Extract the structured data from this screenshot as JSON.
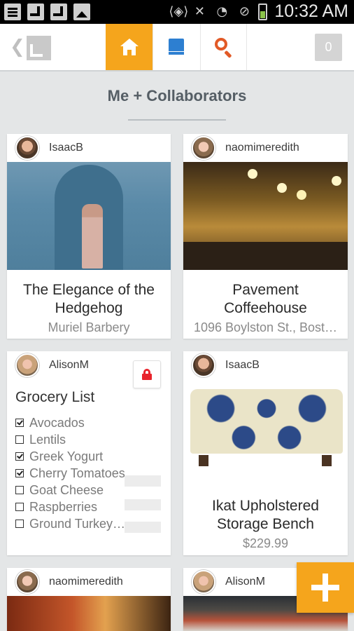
{
  "status_bar": {
    "time": "10:32 AM",
    "left_icons": [
      "document-icon",
      "arrow-icon",
      "arrow-icon",
      "image-icon"
    ],
    "right_icons": [
      "vibrate-icon",
      "mute-icon",
      "wifi-icon",
      "no-signal-icon",
      "battery-icon"
    ],
    "battery_color": "#8bc34a"
  },
  "toolbar": {
    "tabs": [
      "home-icon",
      "library-icon",
      "search-icon"
    ],
    "active_tab": "home",
    "accent_color": "#f5a51c",
    "notification_count": "0"
  },
  "section": {
    "title": "Me + Collaborators"
  },
  "cards": [
    {
      "user": "IsaacB",
      "title": "The Elegance of the Hedgehog",
      "subtitle": "Muriel Barbery"
    },
    {
      "user": "naomimeredith",
      "title": "Pavement Coffeehouse",
      "subtitle": "1096 Boylston St., Bost…"
    },
    {
      "user": "AlisonM",
      "title": "Grocery List",
      "locked": true,
      "items": [
        {
          "label": "Avocados",
          "checked": true
        },
        {
          "label": "Lentils",
          "checked": false
        },
        {
          "label": "Greek Yogurt",
          "checked": true
        },
        {
          "label": "Cherry Tomatoes",
          "checked": true
        },
        {
          "label": "Goat Cheese",
          "checked": false
        },
        {
          "label": "Raspberries",
          "checked": false
        },
        {
          "label": "Ground Turkey…",
          "checked": false
        }
      ]
    },
    {
      "user": "IsaacB",
      "title": "Ikat Upholstered Storage Bench",
      "subtitle": "$229.99"
    },
    {
      "user": "naomimeredith"
    },
    {
      "user": "AlisonM"
    }
  ]
}
